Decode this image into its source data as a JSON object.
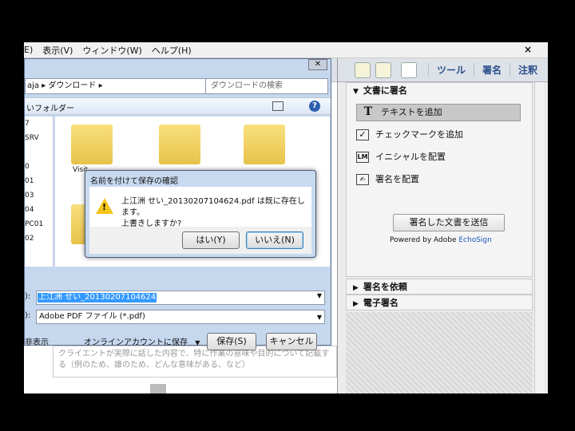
{
  "menubar": {
    "items": [
      "E)",
      "表示(V)",
      "ウィンドウ(W)",
      "ヘルプ(H)"
    ],
    "close": "×"
  },
  "right_pane": {
    "tabs": [
      "ツール",
      "署名",
      "注釈"
    ],
    "section_sign": "文書に署名",
    "items": [
      "テキストを追加",
      "チェックマークを追加",
      "イニシャルを配置",
      "署名を配置"
    ],
    "send_button": "署名した文書を送信",
    "powered_prefix": "Powered by Adobe ",
    "powered_brand": "EchoSign",
    "section_request": "署名を依頼",
    "section_esign": "電子署名"
  },
  "save_dialog": {
    "close_glyph": "✕",
    "address": "aja ▸ ダウンロード ▸",
    "search_placeholder": "ダウンロードの検索",
    "new_folder": "いフォルダー",
    "nav_items": [
      "7",
      "SRV",
      "",
      "",
      "0",
      "01",
      "03",
      "04",
      "PC01",
      "02"
    ],
    "folders": [
      "Visit",
      "",
      "",
      ""
    ],
    "filename_label": "):",
    "filename_value": "上江洲 せい_20130207104624",
    "filetype_label": "):",
    "filetype_value": "Adobe PDF ファイル (*.pdf)",
    "hide_folders": "非表示",
    "online_account": "オンラインアカウントに保存",
    "save_button": "保存(S)",
    "cancel_button": "キャンセル"
  },
  "confirm_dialog": {
    "title": "名前を付けて保存の確認",
    "message_line1": "上江洲 せい_20130207104624.pdf は既に存在します。",
    "message_line2": "上書きしますか?",
    "yes_button": "はい(Y)",
    "no_button": "いいえ(N)"
  },
  "document": {
    "body_text": "クライエントが実際に話した内容で、特に作業の意味や目的について記載する（例のため、誰のため、どんな意味がある、など）"
  },
  "colors": {
    "tab_text": "#2a4e8a",
    "selection": "#3399ff",
    "brand_link": "#1a56b8",
    "warning": "#f3c51b"
  }
}
